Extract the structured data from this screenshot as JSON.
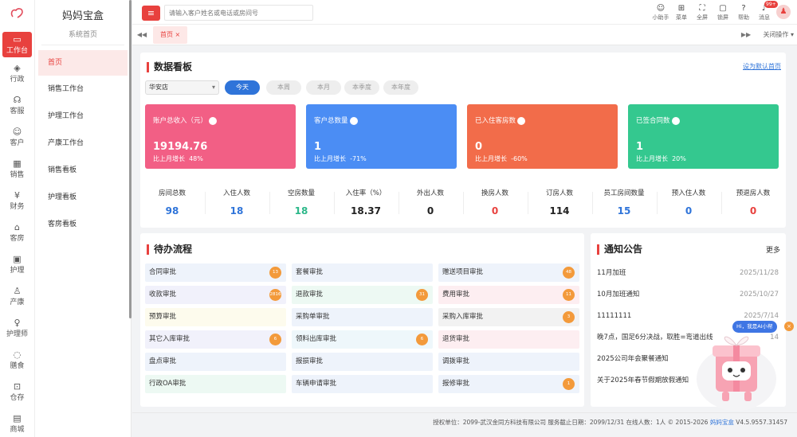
{
  "rail": {
    "logo_icon": "brand-logo",
    "items": [
      {
        "label": "工作台",
        "icon": "▭",
        "active": true
      },
      {
        "label": "行政",
        "icon": "◈"
      },
      {
        "label": "客服",
        "icon": "☊"
      },
      {
        "label": "客户",
        "icon": "☺"
      },
      {
        "label": "销售",
        "icon": "▦"
      },
      {
        "label": "财务",
        "icon": "¥"
      },
      {
        "label": "客房",
        "icon": "⌂"
      },
      {
        "label": "护理",
        "icon": "▣"
      },
      {
        "label": "产康",
        "icon": "♙"
      },
      {
        "label": "护理师",
        "icon": "♀"
      },
      {
        "label": "膳食",
        "icon": "◌"
      },
      {
        "label": "仓存",
        "icon": "⊡"
      },
      {
        "label": "商城",
        "icon": "▤"
      }
    ]
  },
  "menu": {
    "title": "妈妈宝盒",
    "subtitle": "系统首页",
    "items": [
      "首页",
      "销售工作台",
      "护理工作台",
      "产康工作台",
      "销售看板",
      "护理看板",
      "客房看板"
    ]
  },
  "topbar": {
    "menu_icon": "≡",
    "search_placeholder": "请输入客户姓名或电话或房间号",
    "tools": [
      {
        "label": "小助手",
        "icon": "☺"
      },
      {
        "label": "菜单",
        "icon": "⊞"
      },
      {
        "label": "全屏",
        "icon": "⛶"
      },
      {
        "label": "锁屏",
        "icon": "▢"
      },
      {
        "label": "帮助",
        "icon": "?"
      },
      {
        "label": "消息",
        "icon": "♪",
        "badge": "99+"
      }
    ],
    "avatar_icon": "♟"
  },
  "tabbar": {
    "prev": "◀◀",
    "tab": "首页",
    "tab_close": "×",
    "next": "▶▶",
    "close_ops": "关闭操作 ▾"
  },
  "dashboard": {
    "title": "数据看板",
    "set_default": "设为默认首页",
    "store": "华安店",
    "caret": "▾",
    "periods": [
      "今天",
      "本周",
      "本月",
      "本季度",
      "本年度"
    ],
    "stats": [
      {
        "label": "账户总收入（元）",
        "value": "19194.76",
        "growth_label": "比上月增长",
        "growth": "48%",
        "color": "#f25f85"
      },
      {
        "label": "客户总数量",
        "value": "1",
        "growth_label": "比上月增长",
        "growth": "-71%",
        "color": "#4b8df4"
      },
      {
        "label": "已入住客房数",
        "value": "0",
        "growth_label": "比上月增长",
        "growth": "-60%",
        "color": "#f26c4a"
      },
      {
        "label": "已签合同数",
        "value": "1",
        "growth_label": "比上月增长",
        "growth": "20%",
        "color": "#34c88f"
      }
    ],
    "stat_help": "?",
    "metrics": [
      {
        "label": "房间总数",
        "value": "98",
        "color": "#2f74d9"
      },
      {
        "label": "入住人数",
        "value": "18",
        "color": "#2f74d9"
      },
      {
        "label": "空房数量",
        "value": "18",
        "color": "#2db88a"
      },
      {
        "label": "入住率（%）",
        "value": "18.37",
        "color": "#222"
      },
      {
        "label": "外出人数",
        "value": "0",
        "color": "#222"
      },
      {
        "label": "换房人数",
        "value": "0",
        "color": "#e8413e"
      },
      {
        "label": "订房人数",
        "value": "114",
        "color": "#222"
      },
      {
        "label": "员工房间数量",
        "value": "15",
        "color": "#2f74d9"
      },
      {
        "label": "预入住人数",
        "value": "0",
        "color": "#2f74d9"
      },
      {
        "label": "预退房人数",
        "value": "0",
        "color": "#e8413e"
      }
    ]
  },
  "todo": {
    "title": "待办流程",
    "items": [
      {
        "label": "合同审批",
        "badge": "13",
        "bg": "#eef3fb"
      },
      {
        "label": "套餐审批",
        "badge": "",
        "bg": "#eef3fb"
      },
      {
        "label": "赠送项目审批",
        "badge": "48",
        "bg": "#eef3fb"
      },
      {
        "label": "收款审批",
        "badge": "2816",
        "bg": "#f1f1fb"
      },
      {
        "label": "退款审批",
        "badge": "31",
        "bg": "#edf9f3"
      },
      {
        "label": "费用审批",
        "badge": "11",
        "bg": "#fdeef1"
      },
      {
        "label": "预算审批",
        "badge": "",
        "bg": "#fdfbed"
      },
      {
        "label": "采购单审批",
        "badge": "",
        "bg": "#eef3fb"
      },
      {
        "label": "采购入库审批",
        "badge": "3",
        "bg": "#f2f2f2"
      },
      {
        "label": "其它入库审批",
        "badge": "6",
        "bg": "#f1f1fb"
      },
      {
        "label": "领料出库审批",
        "badge": "6",
        "bg": "#eef7fb"
      },
      {
        "label": "退货审批",
        "badge": "",
        "bg": "#fdeef1"
      },
      {
        "label": "盘点审批",
        "badge": "",
        "bg": "#eef3fb"
      },
      {
        "label": "报损审批",
        "badge": "",
        "bg": "#eef3fb"
      },
      {
        "label": "调拨审批",
        "badge": "",
        "bg": "#eef3fb"
      },
      {
        "label": "行政OA审批",
        "badge": "",
        "bg": "#edf9f3"
      },
      {
        "label": "车辆申请审批",
        "badge": "",
        "bg": "#eef3fb"
      },
      {
        "label": "报修审批",
        "badge": "1",
        "bg": "#eef3fb"
      }
    ]
  },
  "notices": {
    "title": "通知公告",
    "more": "更多",
    "items": [
      {
        "title": "11月加班",
        "date": "2025/11/28"
      },
      {
        "title": "10月加班通知",
        "date": "2025/10/27"
      },
      {
        "title": "11111111",
        "date": "2025/7/14"
      },
      {
        "title": "晚7点，国足6分决战，取胜=弯道出线",
        "date": "14"
      },
      {
        "title": "2025公司年会聚餐通知",
        "date": ""
      },
      {
        "title": "关于2025年春节假期放假通知",
        "date": ""
      }
    ]
  },
  "assistant": {
    "bubble": "Hi，我是AI小帮",
    "close": "×"
  },
  "footer": {
    "text": "授权单位：2099-武汉金同方科技有限公司 服务截止日期：2099/12/31 在线人数：1人 © 2015-2026",
    "brand": "妈妈宝盒",
    "version": "V4.5.9557.31457"
  }
}
